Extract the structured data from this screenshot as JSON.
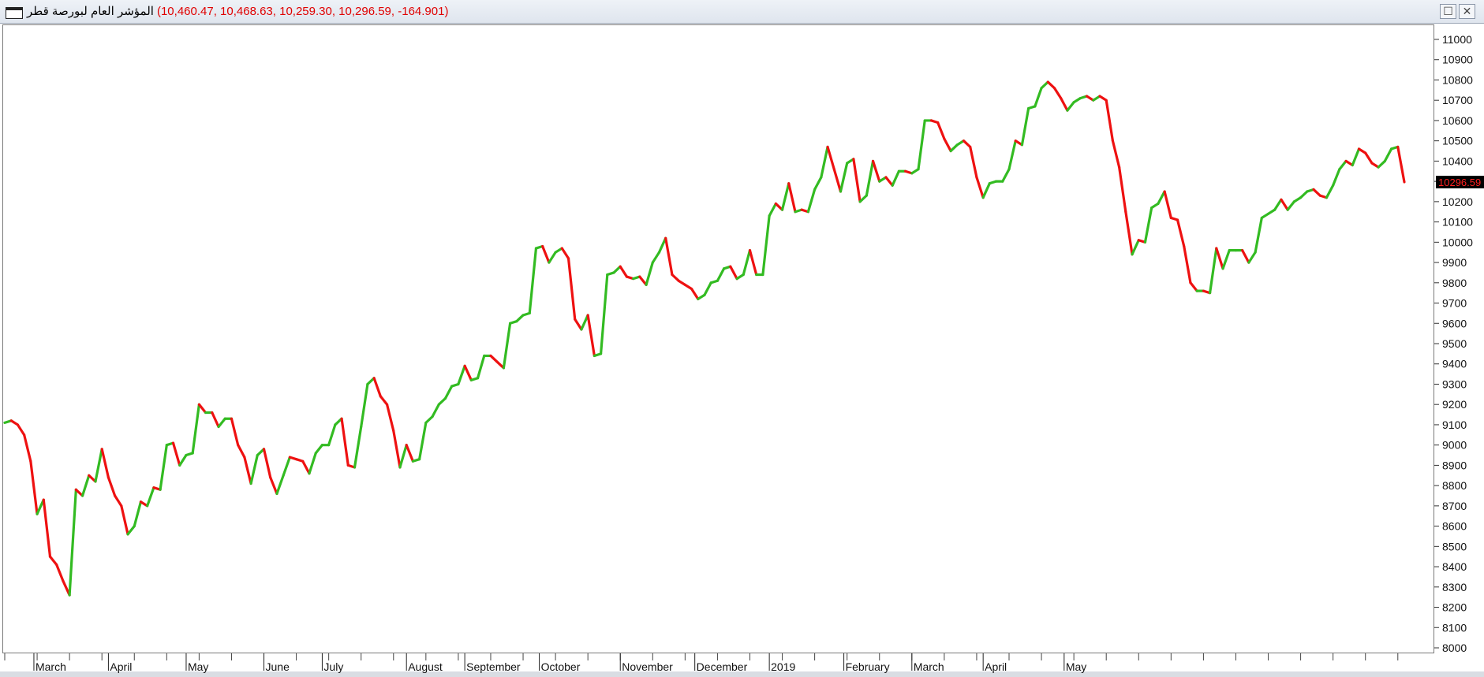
{
  "window": {
    "title_name": "المؤشر العام لبورصة قطر",
    "title_values": "(10,460.47, 10,468.63, 10,259.30, 10,296.59, -164.901)",
    "buttons": {
      "maximize": "☐",
      "close": "✕"
    }
  },
  "colors": {
    "up": "#33bb22",
    "down": "#ee1111",
    "marker_bg": "#000000",
    "marker_text": "#ff2020"
  },
  "chart_data": {
    "type": "line",
    "title": "",
    "xlabel": "",
    "ylabel": "",
    "ylim": [
      8000,
      11000
    ],
    "yticks": [
      8000,
      8100,
      8200,
      8300,
      8400,
      8500,
      8600,
      8700,
      8800,
      8900,
      9000,
      9100,
      9200,
      9300,
      9400,
      9500,
      9600,
      9700,
      9800,
      9900,
      10000,
      10100,
      10200,
      10300,
      10400,
      10500,
      10600,
      10700,
      10800,
      10900,
      11000
    ],
    "ytick_labels": [
      "8000",
      "8100",
      "8200",
      "8300",
      "8400",
      "8500",
      "8600",
      "8700",
      "8800",
      "8900",
      "9000",
      "9100",
      "9200",
      "9300",
      "9400",
      "9500",
      "9600",
      "9700",
      "9800",
      "9900",
      "10000",
      "10100",
      "10200",
      "10300",
      "10400",
      "10500",
      "10600",
      "10700",
      "10800",
      "10900",
      "11000"
    ],
    "month_labels": [
      {
        "label": "March",
        "index": 4.5
      },
      {
        "label": "April",
        "index": 16
      },
      {
        "label": "May",
        "index": 28
      },
      {
        "label": "June",
        "index": 40
      },
      {
        "label": "July",
        "index": 49
      },
      {
        "label": "August",
        "index": 62
      },
      {
        "label": "September",
        "index": 71
      },
      {
        "label": "October",
        "index": 82.5
      },
      {
        "label": "November",
        "index": 95
      },
      {
        "label": "December",
        "index": 106.5
      },
      {
        "label": "2019",
        "index": 118
      },
      {
        "label": "February",
        "index": 129.5
      },
      {
        "label": "March",
        "index": 140
      },
      {
        "label": "April",
        "index": 151
      },
      {
        "label": "May",
        "index": 163.5
      }
    ],
    "last_value_label": "10296.59",
    "series": [
      {
        "values": [
          9110,
          9120,
          9100,
          9050,
          8920,
          8660,
          8730,
          8450,
          8410,
          8330,
          8260,
          8780,
          8750,
          8850,
          8820,
          8980,
          8840,
          8750,
          8700,
          8560,
          8600,
          8720,
          8700,
          8790,
          8780,
          9000,
          9010,
          8900,
          8950,
          8960,
          9200,
          9160,
          9160,
          9090,
          9130,
          9130,
          9000,
          8940,
          8810,
          8950,
          8980,
          8840,
          8760,
          8850,
          8940,
          8930,
          8920,
          8860,
          8960,
          9000,
          9000,
          9100,
          9130,
          8900,
          8890,
          9090,
          9300,
          9330,
          9240,
          9200,
          9070,
          8890,
          9000,
          8920,
          8930,
          9110,
          9140,
          9200,
          9230,
          9290,
          9300,
          9390,
          9320,
          9330,
          9440,
          9440,
          9410,
          9380,
          9600,
          9610,
          9640,
          9650,
          9970,
          9980,
          9900,
          9950,
          9970,
          9920,
          9620,
          9570,
          9640,
          9440,
          9450,
          9840,
          9850,
          9880,
          9830,
          9820,
          9830,
          9790,
          9900,
          9950,
          10020,
          9840,
          9810,
          9790,
          9770,
          9720,
          9740,
          9800,
          9810,
          9870,
          9880,
          9820,
          9840,
          9960,
          9840,
          9840,
          10130,
          10190,
          10160,
          10290,
          10150,
          10160,
          10150,
          10260,
          10320,
          10470,
          10360,
          10250,
          10390,
          10410,
          10200,
          10230,
          10400,
          10300,
          10320,
          10280,
          10350,
          10350,
          10340,
          10360,
          10600,
          10600,
          10590,
          10510,
          10450,
          10480,
          10500,
          10470,
          10320,
          10220,
          10290,
          10300,
          10300,
          10360,
          10500,
          10480,
          10660,
          10670,
          10760,
          10790,
          10760,
          10710,
          10650,
          10690,
          10710,
          10720,
          10700,
          10720,
          10700,
          10500,
          10370,
          10150,
          9940,
          10010,
          10000,
          10170,
          10190,
          10250,
          10120,
          10110,
          9980,
          9800,
          9760,
          9760,
          9750,
          9970,
          9870,
          9960,
          9960,
          9960,
          9900,
          9950,
          10120,
          10140,
          10160,
          10210,
          10160,
          10200,
          10220,
          10250,
          10260,
          10230,
          10220,
          10280,
          10360,
          10400,
          10380,
          10460,
          10440,
          10390,
          10370,
          10400,
          10460,
          10470,
          10296.59
        ]
      }
    ]
  }
}
